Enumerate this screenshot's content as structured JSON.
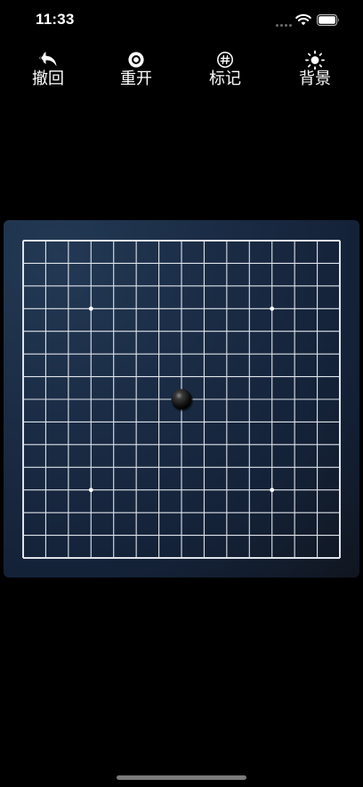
{
  "status_bar": {
    "time": "11:33",
    "icons": [
      "cellular-signal-icon",
      "wifi-icon",
      "battery-icon"
    ]
  },
  "toolbar": {
    "undo": {
      "label": "撤回",
      "icon": "undo-arrow-icon"
    },
    "restart": {
      "label": "重开",
      "icon": "restart-ring-icon"
    },
    "mark": {
      "label": "标记",
      "icon": "hash-circle-icon"
    },
    "background": {
      "label": "背景",
      "icon": "sun-icon"
    }
  },
  "board": {
    "lines": 15,
    "star_points": [
      [
        3,
        3
      ],
      [
        11,
        3
      ],
      [
        3,
        11
      ],
      [
        11,
        11
      ]
    ],
    "stones": [
      {
        "col": 7,
        "row": 7,
        "color": "black"
      }
    ],
    "colors": {
      "grid": "#dfe3ea",
      "panel": "#1a2b44",
      "black_stone": "#111111"
    }
  }
}
